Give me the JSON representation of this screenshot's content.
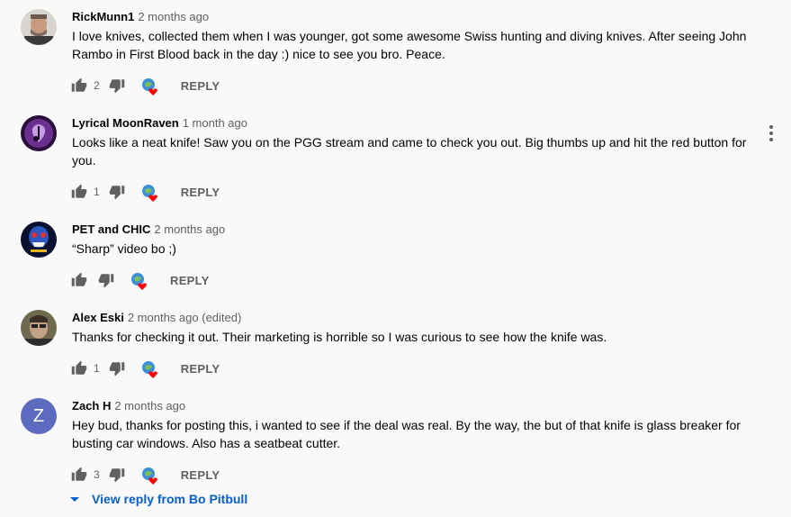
{
  "comments": [
    {
      "author": "RickMunn1",
      "time": "2 months ago",
      "edited": "",
      "text": "I love knives, collected them when I was younger, got some awesome Swiss hunting and diving knives. After seeing John Rambo in First Blood back in the day :) nice to see you bro. Peace.",
      "likes": "2",
      "reply": "REPLY"
    },
    {
      "author": "Lyrical MoonRaven",
      "time": "1 month ago",
      "edited": "",
      "text": "Looks like a neat knife! Saw you on the PGG stream and came to check you out. Big thumbs up and hit the red button for you.",
      "likes": "1",
      "reply": "REPLY"
    },
    {
      "author": "PET and CHIC",
      "time": "2 months ago",
      "edited": "",
      "text": "“Sharp” video bo ;)",
      "likes": "",
      "reply": "REPLY"
    },
    {
      "author": "Alex Eski",
      "time": "2 months ago",
      "edited": "(edited)",
      "text": "Thanks for checking it out. Their marketing is horrible so I was curious to see how the knife was.",
      "likes": "1",
      "reply": "REPLY"
    },
    {
      "author": "Zach H",
      "time": "2 months ago",
      "edited": "",
      "text": "Hey bud, thanks for posting this, i wanted to see if the deal was real. By the way, the  but of that knife is  glass breaker for  busting car windows. Also has a seatbeat cutter.",
      "likes": "3",
      "reply": "REPLY",
      "avatar_letter": "Z"
    }
  ],
  "view_reply": "View reply from Bo Pitbull",
  "colors": {
    "background": "#f9f9f9",
    "link": "#065fd4",
    "secondary_text": "#606060",
    "heart": "#ff0000",
    "avatar_z": "#5c6bc0"
  }
}
